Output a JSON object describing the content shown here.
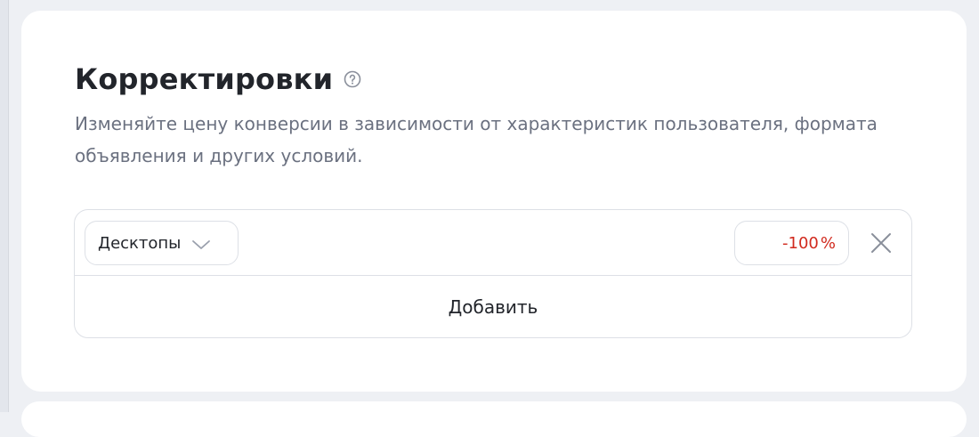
{
  "section": {
    "title": "Корректировки",
    "description": "Изменяйте цену конверсии в зависимости от характеристик пользователя, формата объявления и других условий."
  },
  "adjustment": {
    "device": "Десктопы",
    "value": "-100",
    "unit": "%",
    "value_color": "#d12a1e"
  },
  "add_button": "Добавить",
  "icons": {
    "help": "question-circle-icon",
    "dropdown": "chevron-down-icon",
    "remove": "close-icon"
  }
}
